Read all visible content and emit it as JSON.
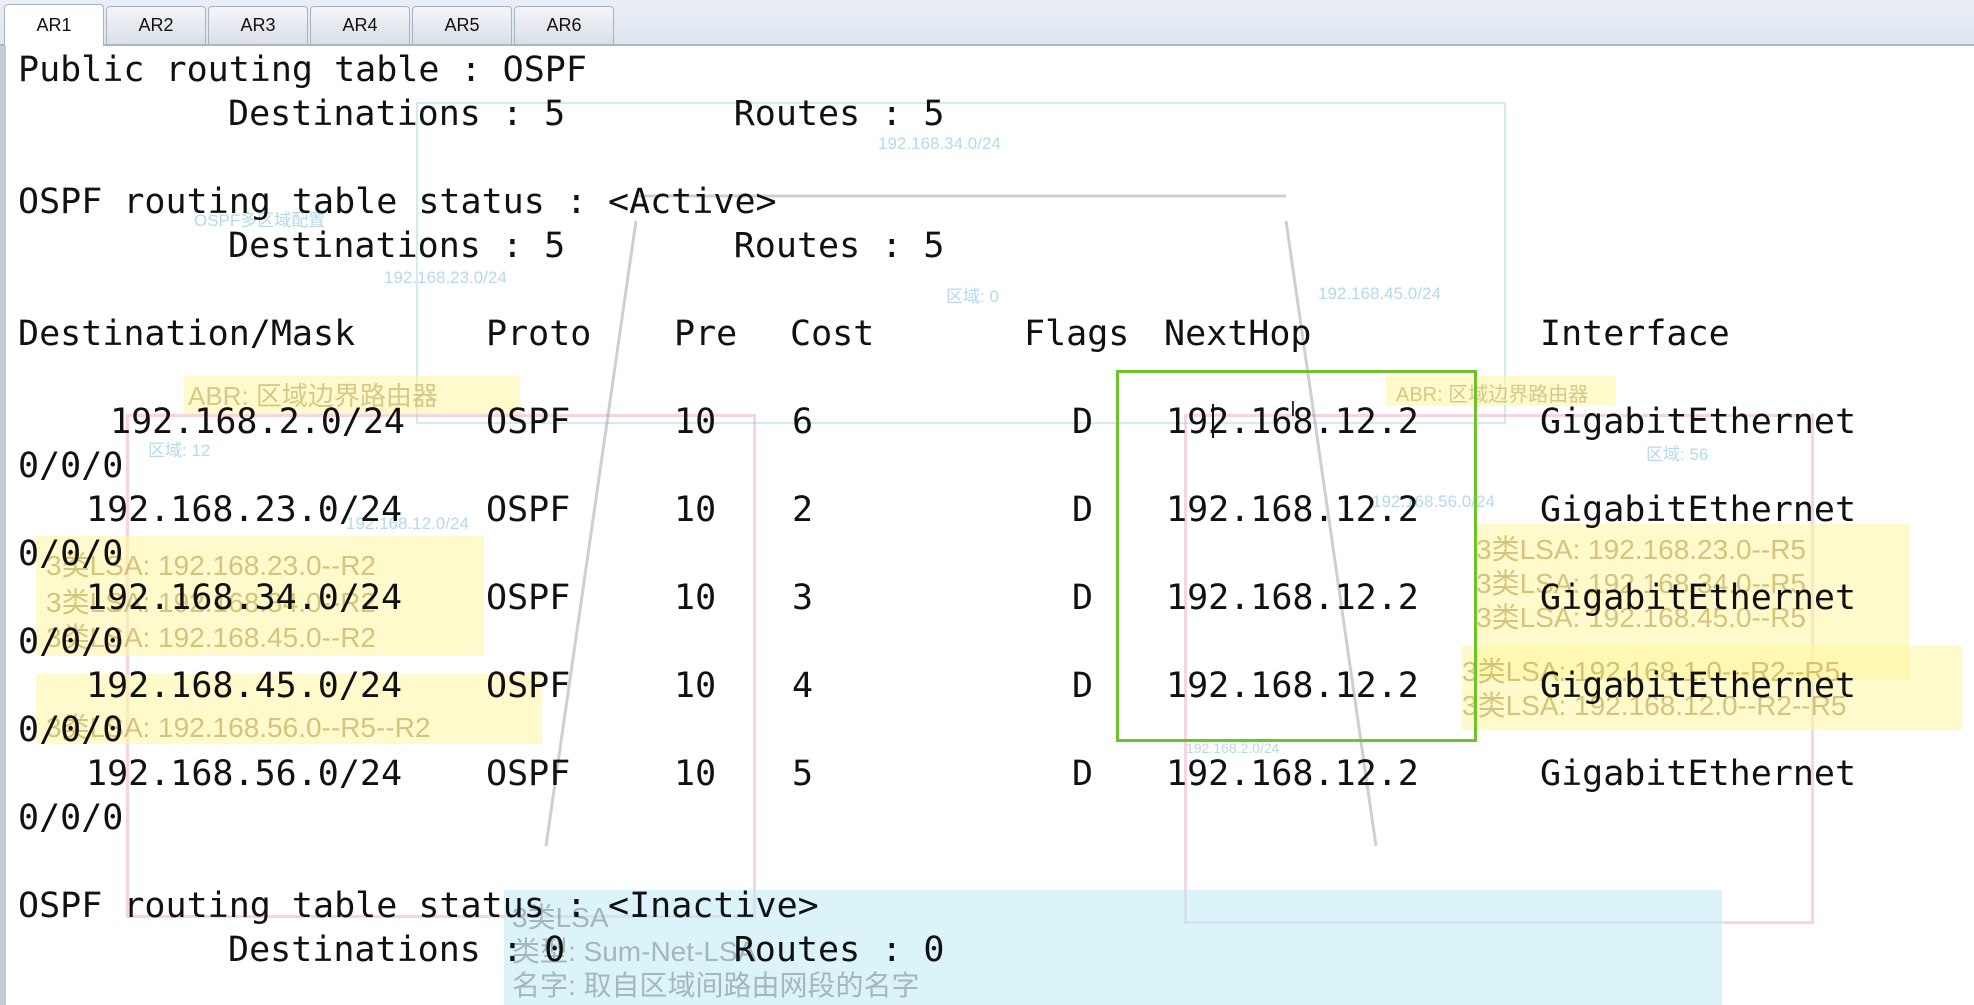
{
  "tabs": [
    {
      "label": "AR1",
      "active": true
    },
    {
      "label": "AR2",
      "active": false
    },
    {
      "label": "AR3",
      "active": false
    },
    {
      "label": "AR4",
      "active": false
    },
    {
      "label": "AR5",
      "active": false
    },
    {
      "label": "AR6",
      "active": false
    }
  ],
  "console": {
    "public_title": "Public routing table : OSPF",
    "public_counts": "Destinations : 5        Routes : 5",
    "active_title": "OSPF routing table status : <Active>",
    "active_counts": "Destinations : 5        Routes : 5",
    "headers": {
      "dest": "Destination/Mask",
      "proto": "Proto",
      "pre": "Pre",
      "cost": "Cost",
      "flags": "Flags",
      "nexthop": "NextHop",
      "iface": "Interface"
    },
    "routes": [
      {
        "dest": "192.168.2.0/24",
        "proto": "OSPF",
        "pre": "10",
        "cost": "6",
        "flags": "D",
        "nexthop": "192.168.12.2",
        "iface": "GigabitEthernet",
        "iface_cont": "0/0/0"
      },
      {
        "dest": "192.168.23.0/24",
        "proto": "OSPF",
        "pre": "10",
        "cost": "2",
        "flags": "D",
        "nexthop": "192.168.12.2",
        "iface": "GigabitEthernet",
        "iface_cont": "0/0/0"
      },
      {
        "dest": "192.168.34.0/24",
        "proto": "OSPF",
        "pre": "10",
        "cost": "3",
        "flags": "D",
        "nexthop": "192.168.12.2",
        "iface": "GigabitEthernet",
        "iface_cont": "0/0/0"
      },
      {
        "dest": "192.168.45.0/24",
        "proto": "OSPF",
        "pre": "10",
        "cost": "4",
        "flags": "D",
        "nexthop": "192.168.12.2",
        "iface": "GigabitEthernet",
        "iface_cont": "0/0/0"
      },
      {
        "dest": "192.168.56.0/24",
        "proto": "OSPF",
        "pre": "10",
        "cost": "5",
        "flags": "D",
        "nexthop": "192.168.12.2",
        "iface": "GigabitEthernet",
        "iface_cont": "0/0/0"
      }
    ],
    "inactive_title": "OSPF routing table status : <Inactive>",
    "inactive_counts": "Destinations : 0        Routes : 0"
  },
  "overlay": {
    "net_34": "192.168.34.0/24",
    "net_23": "192.168.23.0/24",
    "net_45": "192.168.45.0/24",
    "net_12": "192.168.12.0/24",
    "net_56": "192.168.56.0/24",
    "net_2": "192.168.2.0/24",
    "area0": "区域: 0",
    "area12": "区域: 12",
    "area56": "区域: 56",
    "abr_left": "ABR: 区域边界路由器",
    "abr_right": "ABR: 区域边界路由器",
    "ospf_note": "OSPF多区域配置",
    "lsa_left": [
      "3类LSA: 192.168.23.0--R2",
      "3类LSA: 192.168.34.0--R2",
      "3类LSA: 192.168.45.0--R2",
      "3类LSA: 192.168.56.0--R5--R2"
    ],
    "lsa_right": [
      "3类LSA: 192.168.23.0--R5",
      "3类LSA: 192.168.34.0--R5",
      "3类LSA: 192.168.45.0--R5"
    ],
    "lsa_right2": [
      "3类LSA: 192.168.1.0---R2--R5",
      "3类LSA: 192.168.12.0--R2--R5"
    ],
    "bottom_note": [
      "3类LSA",
      "类型: Sum-Net-LSA",
      "名字: 取自区域间路由网段的名字"
    ]
  },
  "colors": {
    "highlight_border": "#6cc42a"
  }
}
